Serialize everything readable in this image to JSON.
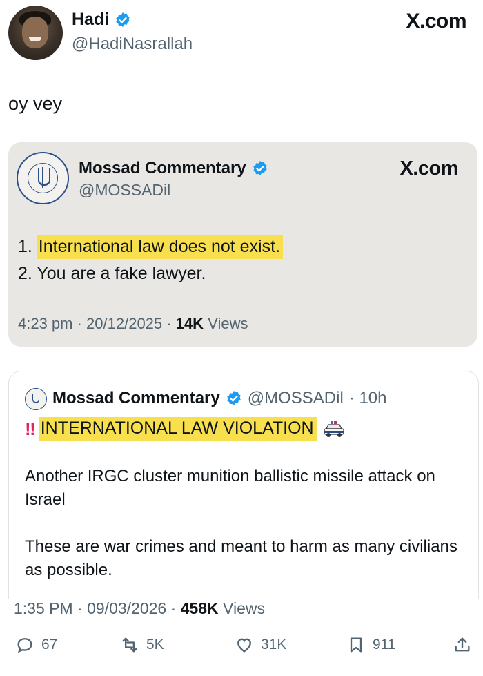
{
  "author": {
    "name": "Hadi",
    "handle": "@HadiNasrallah"
  },
  "brand": "X.com",
  "tweet_text": "oy vey",
  "quoted": {
    "name": "Mossad Commentary",
    "handle": "@MOSSADil",
    "brand": "X.com",
    "line1_prefix": "1. ",
    "line1_highlight": "International law does not exist.",
    "line2": "2. You are a fake lawyer.",
    "time": "4:23 pm · 20/12/2025 · ",
    "views_count": "14K",
    "views_label": " Views"
  },
  "embedded": {
    "name": "Mossad Commentary",
    "handle": "@MOSSADil",
    "age": "· 10h",
    "alert": "‼",
    "headline": "INTERNATIONAL LAW VIOLATION",
    "emoji": "police-car-icon",
    "para1": "Another IRGC cluster munition ballistic missile attack on Israel",
    "para2": "These are war crimes and meant to harm as many civilians as possible."
  },
  "footer": {
    "time": "1:35 PM · 09/03/2026 · ",
    "views_count": "458K",
    "views_label": " Views"
  },
  "actions": {
    "replies": "67",
    "reposts": "5K",
    "likes": "31K",
    "bookmarks": "911"
  },
  "colors": {
    "highlight": "#f7df4d",
    "verified": "#1d9bf0",
    "muted": "#536471"
  }
}
